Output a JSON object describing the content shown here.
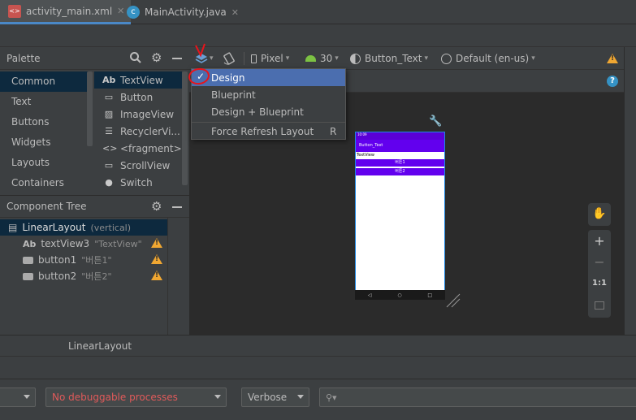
{
  "tabs": [
    {
      "label": "activity_main.xml",
      "icon": "xml-file-icon",
      "active": true
    },
    {
      "label": "MainActivity.java",
      "icon": "java-class-icon",
      "active": false
    }
  ],
  "palette": {
    "title": "Palette",
    "categories": [
      "Common",
      "Text",
      "Buttons",
      "Widgets",
      "Layouts",
      "Containers"
    ],
    "items": [
      {
        "icon": "Ab",
        "label": "TextView"
      },
      {
        "icon": "▭",
        "label": "Button"
      },
      {
        "icon": "▨",
        "label": "ImageView"
      },
      {
        "icon": "☰",
        "label": "RecyclerVi..."
      },
      {
        "icon": "<>",
        "label": "<fragment>"
      },
      {
        "icon": "▭",
        "label": "ScrollView"
      },
      {
        "icon": "●",
        "label": "Switch"
      }
    ]
  },
  "component_tree": {
    "title": "Component Tree",
    "rows": [
      {
        "icon": "▤",
        "label": "LinearLayout",
        "sub": "(vertical)"
      },
      {
        "icon": "Ab",
        "label": "textView3",
        "sub": "\"TextView\""
      },
      {
        "icon": "▭",
        "label": "button1",
        "sub": "\"버튼1\""
      },
      {
        "icon": "▭",
        "label": "button2",
        "sub": "\"버튼2\""
      }
    ]
  },
  "toolbar": {
    "device": "Pixel",
    "api": "30",
    "theme": "Button_Text",
    "locale": "Default (en-us)"
  },
  "dropdown": {
    "items": [
      "Design",
      "Blueprint",
      "Design + Blueprint"
    ],
    "refresh_label": "Force Refresh Layout",
    "refresh_shortcut": "R",
    "selected": "Design"
  },
  "phone": {
    "status": "10:09",
    "app_title": "Button_Text",
    "textview": "TextView",
    "button1": "버튼1",
    "button2": "버튼2"
  },
  "zoom": {
    "plus": "+",
    "minus": "−",
    "ratio": "1:1"
  },
  "statusbar": {
    "breadcrumb": "LinearLayout"
  },
  "logcat": {
    "process": "No debuggable processes",
    "level": "Verbose",
    "search_placeholder": ""
  },
  "colors": {
    "accent": "#4b6eaf",
    "warning": "#f0a732",
    "purple": "#6200ee",
    "annotation": "#e8141b"
  }
}
